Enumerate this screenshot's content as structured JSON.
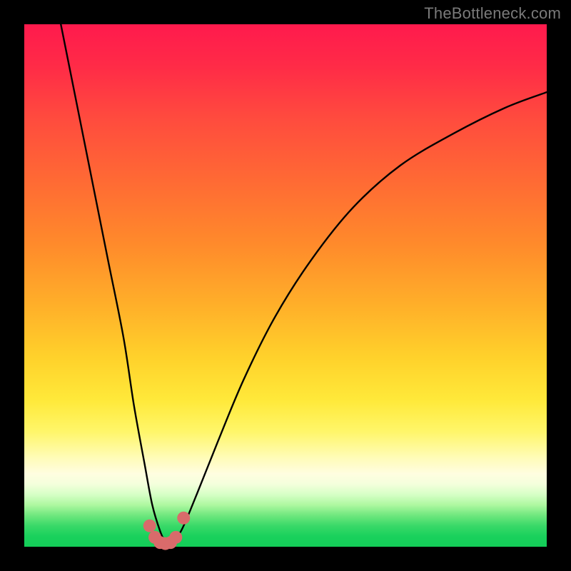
{
  "watermark": "TheBottleneck.com",
  "chart_data": {
    "type": "line",
    "title": "",
    "xlabel": "",
    "ylabel": "",
    "xlim": [
      0,
      100
    ],
    "ylim": [
      0,
      100
    ],
    "series": [
      {
        "name": "bottleneck-curve",
        "x": [
          7,
          10,
          13,
          16,
          19,
          21,
          23,
          24.5,
          26,
          27,
          28,
          30,
          33,
          37,
          42,
          48,
          55,
          63,
          72,
          82,
          92,
          100
        ],
        "y": [
          100,
          85,
          70,
          55,
          40,
          27,
          16,
          8,
          3,
          1,
          1,
          3,
          10,
          20,
          32,
          44,
          55,
          65,
          73,
          79,
          84,
          87
        ]
      }
    ],
    "markers": {
      "name": "highlight-dots",
      "color": "#d96b6b",
      "x": [
        24.0,
        25.0,
        26.0,
        27.0,
        28.0,
        29.0,
        30.5
      ],
      "y": [
        4.0,
        1.8,
        0.8,
        0.6,
        0.8,
        1.8,
        5.5
      ]
    },
    "background_gradient": [
      "#ff1a4d",
      "#ff8a2b",
      "#ffe93a",
      "#fffde0",
      "#13cd58"
    ]
  }
}
